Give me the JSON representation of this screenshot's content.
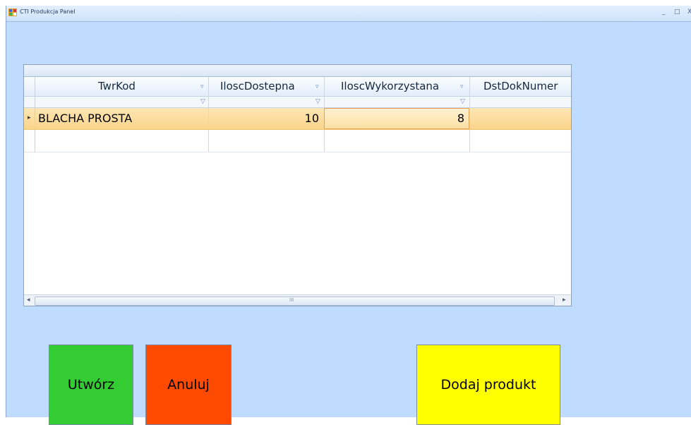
{
  "window": {
    "title": "CTI Produkcja Panel",
    "minimize": "_",
    "maximize": "□",
    "close": "X"
  },
  "grid": {
    "columns": [
      "TwrKod",
      "IloscDostepna",
      "IloscWykorzystana",
      "DstDokNumer"
    ],
    "rows": [
      {
        "TwrKod": "BLACHA PROSTA",
        "IloscDostepna": "10",
        "IloscWykorzystana": "8",
        "DstDokNumer": ""
      }
    ],
    "row_indicator": "▸",
    "filter_icon": "funnel-icon",
    "scroll_left": "◂",
    "scroll_right": "▸",
    "scroll_grip": "III"
  },
  "buttons": {
    "create": {
      "label": "Utwórz",
      "color": "#33cc33"
    },
    "cancel": {
      "label": "Anuluj",
      "color": "#ff4a00"
    },
    "add": {
      "label": "Dodaj produkt",
      "color": "#ffff00"
    }
  }
}
